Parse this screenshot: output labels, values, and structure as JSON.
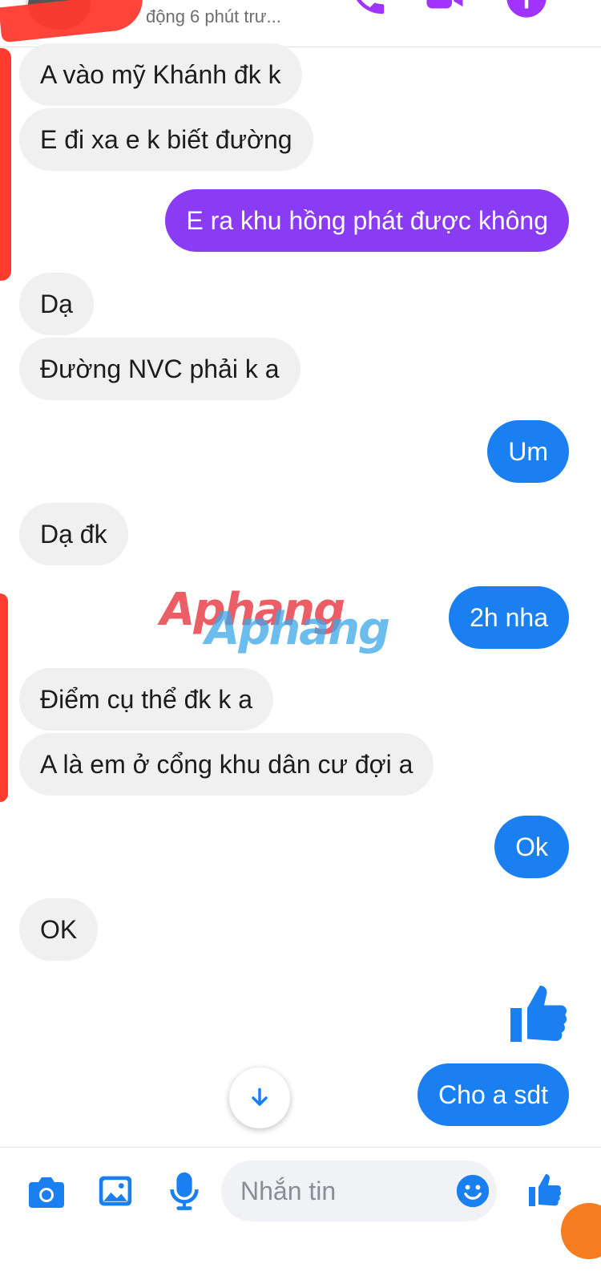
{
  "header": {
    "status": "động 6 phút trư...",
    "icons": [
      "phone-icon",
      "video-icon",
      "info-icon"
    ]
  },
  "messages": [
    {
      "side": "in",
      "text": "A vào mỹ Khánh đk k"
    },
    {
      "side": "in",
      "text": "E đi xa e k biết đường"
    },
    {
      "side": "out",
      "text": "E ra khu hồng phát được không"
    },
    {
      "side": "in",
      "text": "Dạ"
    },
    {
      "side": "in",
      "text": "Đường NVC phải k a"
    },
    {
      "side": "out",
      "text": "Um"
    },
    {
      "side": "in",
      "text": "Dạ đk"
    },
    {
      "side": "out",
      "text": "2h nha"
    },
    {
      "side": "in",
      "text": "Điểm cụ thể đk k a"
    },
    {
      "side": "in",
      "text": "A là em ở cổng khu dân cư đợi a"
    },
    {
      "side": "out",
      "text": "Ok"
    },
    {
      "side": "in",
      "text": "OK"
    },
    {
      "side": "out",
      "text": "Cho a sdt"
    }
  ],
  "watermark": {
    "text": "Aphang"
  },
  "composer": {
    "placeholder": "Nhắn tin",
    "icons": [
      "camera-icon",
      "gallery-icon",
      "microphone-icon",
      "emoji-icon",
      "like-icon"
    ]
  },
  "colors": {
    "outgoing_purple": "#8a3cf5",
    "outgoing_blue": "#1a7ff0",
    "incoming_bg": "#f1f0f0",
    "accent": "#1a7ff0"
  }
}
